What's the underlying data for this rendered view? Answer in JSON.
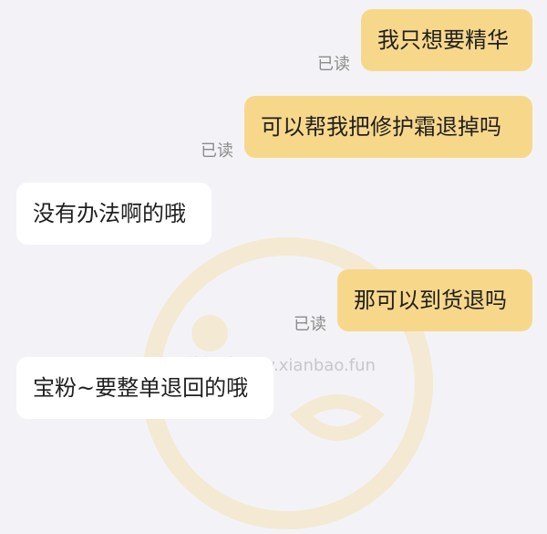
{
  "messages": [
    {
      "side": "out",
      "text": "我只想要精华",
      "status": "已读"
    },
    {
      "side": "out",
      "text": "可以帮我把修护霜退掉吗",
      "status": "已读"
    },
    {
      "side": "in",
      "text": "没有办法啊的哦"
    },
    {
      "side": "out",
      "text": "那可以到货退吗",
      "status": "已读"
    },
    {
      "side": "in",
      "text": "宝粉~要整单退回的哦"
    }
  ],
  "watermark": {
    "text": "线报酷-new.xianbao.fun"
  },
  "colors": {
    "outgoing_bubble": "#f7d88b",
    "incoming_bubble": "#ffffff",
    "background": "#f3f3f7",
    "read_status": "#8b8b8b"
  }
}
